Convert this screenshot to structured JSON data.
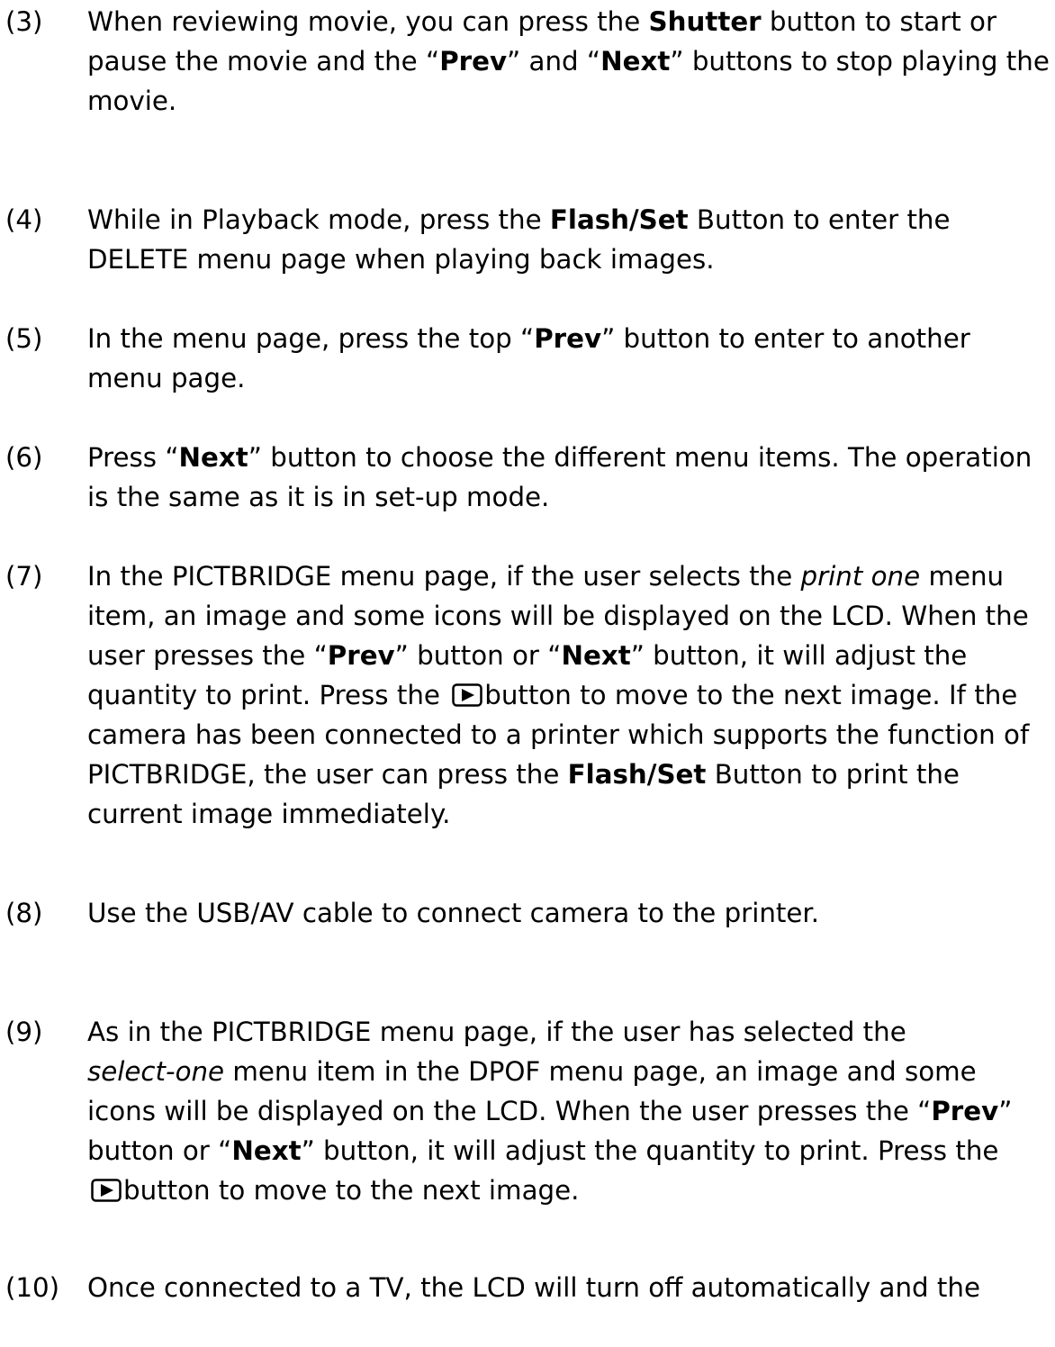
{
  "items": [
    {
      "number": "(3)",
      "lines": [
        [
          {
            "t": "When reviewing movie, you can press the "
          },
          {
            "t": "Shutter",
            "b": true
          },
          {
            "t": " button to start or"
          }
        ],
        [
          {
            "t": "pause the movie and the “"
          },
          {
            "t": "Prev",
            "b": true
          },
          {
            "t": "” and “"
          },
          {
            "t": "Next",
            "b": true
          },
          {
            "t": "” buttons to stop playing the"
          }
        ],
        [
          {
            "t": "movie."
          }
        ]
      ]
    },
    {
      "number": "(4)",
      "lines": [
        [
          {
            "t": "While in Playback mode, press the "
          },
          {
            "t": "Flash/Set",
            "b": true
          },
          {
            "t": " Button to enter the"
          }
        ],
        [
          {
            "t": "DELETE menu page when playing back images."
          }
        ]
      ]
    },
    {
      "number": "(5)",
      "lines": [
        [
          {
            "t": "In the menu page, press the top “"
          },
          {
            "t": "Prev",
            "b": true
          },
          {
            "t": "” button to enter to another"
          }
        ],
        [
          {
            "t": "menu page."
          }
        ]
      ]
    },
    {
      "number": "(6)",
      "lines": [
        [
          {
            "t": "Press “"
          },
          {
            "t": "Next",
            "b": true
          },
          {
            "t": "” button to choose the different menu items. The operation"
          }
        ],
        [
          {
            "t": "is the same as it is in set-up mode."
          }
        ]
      ]
    },
    {
      "number": "(7)",
      "lines": [
        [
          {
            "t": "In the PICTBRIDGE menu page, if the user selects the "
          },
          {
            "t": "print one",
            "i": true
          },
          {
            "t": " menu"
          }
        ],
        [
          {
            "t": "item, an image and some icons will be displayed on the LCD. When the"
          }
        ],
        [
          {
            "t": "user presses the “"
          },
          {
            "t": "Prev",
            "b": true
          },
          {
            "t": "” button or “"
          },
          {
            "t": "Next",
            "b": true
          },
          {
            "t": "” button, it will adjust the"
          }
        ],
        [
          {
            "t": "quantity to print. Press the "
          },
          {
            "icon": "play-button-icon"
          },
          {
            "t": "button to move to the next image. If the"
          }
        ],
        [
          {
            "t": "camera has been connected to a printer which supports the function of"
          }
        ],
        [
          {
            "t": "PICTBRIDGE, the user can press the "
          },
          {
            "t": "Flash/Set",
            "b": true
          },
          {
            "t": " Button to print the"
          }
        ],
        [
          {
            "t": "current image immediately."
          }
        ]
      ]
    },
    {
      "number": "(8)",
      "lines": [
        [
          {
            "t": "Use the USB/AV cable to connect camera to the printer."
          }
        ]
      ]
    },
    {
      "number": "(9)",
      "lines": [
        [
          {
            "t": "As in the PICTBRIDGE menu page, if the user has selected the"
          }
        ],
        [
          {
            "t": "select-one",
            "i": true
          },
          {
            "t": " menu item in the DPOF menu page, an image and some"
          }
        ],
        [
          {
            "t": "icons will be displayed on the LCD. When the user presses the “"
          },
          {
            "t": "Prev",
            "b": true
          },
          {
            "t": "”"
          }
        ],
        [
          {
            "t": "button or “"
          },
          {
            "t": "Next",
            "b": true
          },
          {
            "t": "” button, it will adjust the quantity to print. Press the"
          }
        ],
        [
          {
            "icon": "play-button-icon"
          },
          {
            "t": "button to move to the next image."
          }
        ]
      ]
    },
    {
      "number": "(10)",
      "lines": [
        [
          {
            "t": "Once connected to a TV, the LCD will turn off automatically and the"
          }
        ]
      ]
    }
  ]
}
